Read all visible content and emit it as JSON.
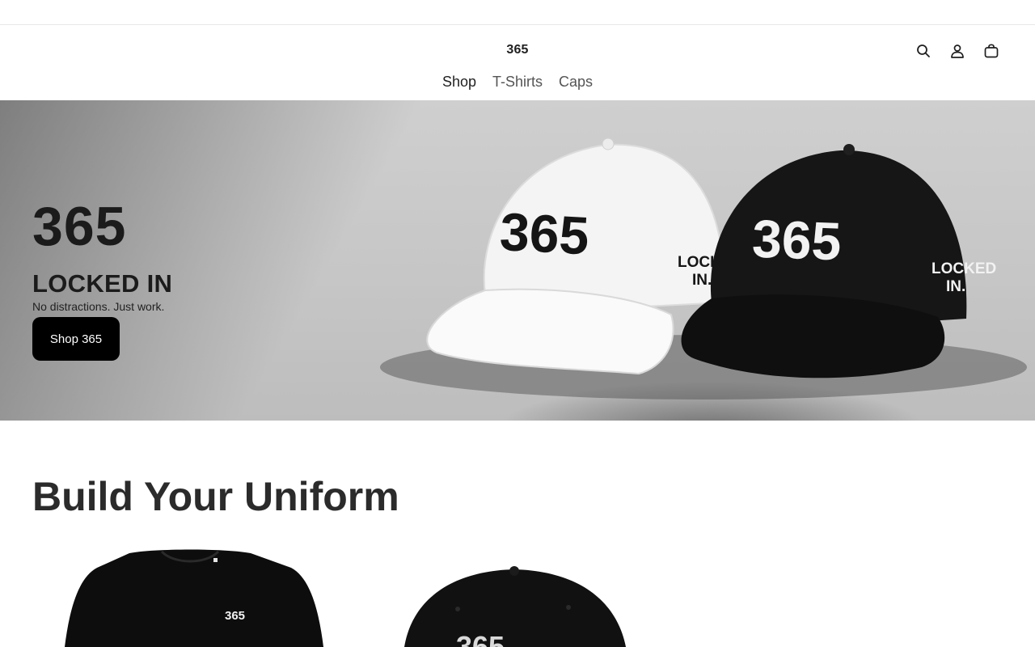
{
  "header": {
    "logo": "365",
    "nav": [
      {
        "label": "Shop"
      },
      {
        "label": "T-Shirts"
      },
      {
        "label": "Caps"
      }
    ],
    "icons": [
      "search-icon",
      "account-icon",
      "cart-icon"
    ]
  },
  "hero": {
    "headline": "365",
    "subheadline": "LOCKED IN",
    "tagline": "No distractions. Just work.",
    "cta_label": "Shop 365",
    "cap_front_text": "365",
    "cap_side_text_1": "LOCKED",
    "cap_side_text_2": "IN."
  },
  "section": {
    "title": "Build Your Uniform"
  },
  "products": [
    {
      "print": "365"
    },
    {
      "print": "365"
    }
  ],
  "colors": {
    "accent": "#000000",
    "text": "#1f1f1f",
    "nav_muted": "#555555"
  }
}
